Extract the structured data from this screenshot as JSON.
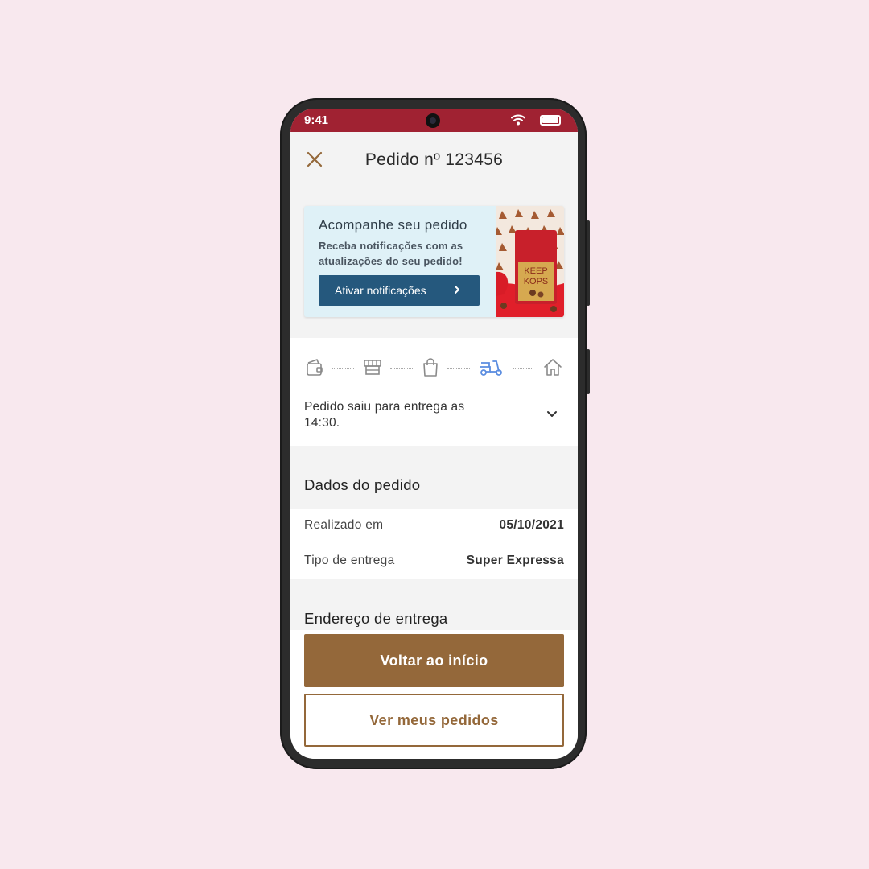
{
  "statusbar": {
    "time": "9:41"
  },
  "header": {
    "title": "Pedido nº 123456"
  },
  "banner": {
    "title": "Acompanhe seu pedido",
    "text": "Receba notificações com as atualizações do seu pedido!",
    "button_label": "Ativar notificações",
    "product_brand": "KEEP KOPS"
  },
  "tracker": {
    "steps": [
      {
        "icon": "wallet-icon",
        "active": false
      },
      {
        "icon": "store-icon",
        "active": false
      },
      {
        "icon": "shopping-bag-icon",
        "active": false
      },
      {
        "icon": "scooter-icon",
        "active": true
      },
      {
        "icon": "home-icon",
        "active": false
      }
    ],
    "status_text": "Pedido saiu para entrega as 14:30.",
    "active_color": "#5b8de0",
    "inactive_color": "#8a8a8a"
  },
  "order_data": {
    "title": "Dados do pedido",
    "rows": [
      {
        "label": "Realizado em",
        "value": "05/10/2021"
      },
      {
        "label": "Tipo de entrega",
        "value": "Super Expressa"
      }
    ]
  },
  "address": {
    "title": "Endereço de entrega"
  },
  "actions": {
    "primary_label": "Voltar ao início",
    "secondary_label": "Ver meus pedidos"
  },
  "colors": {
    "background": "#f8e8ee",
    "statusbar": "#a02232",
    "accent": "#94683a",
    "banner_button": "#25587d"
  }
}
